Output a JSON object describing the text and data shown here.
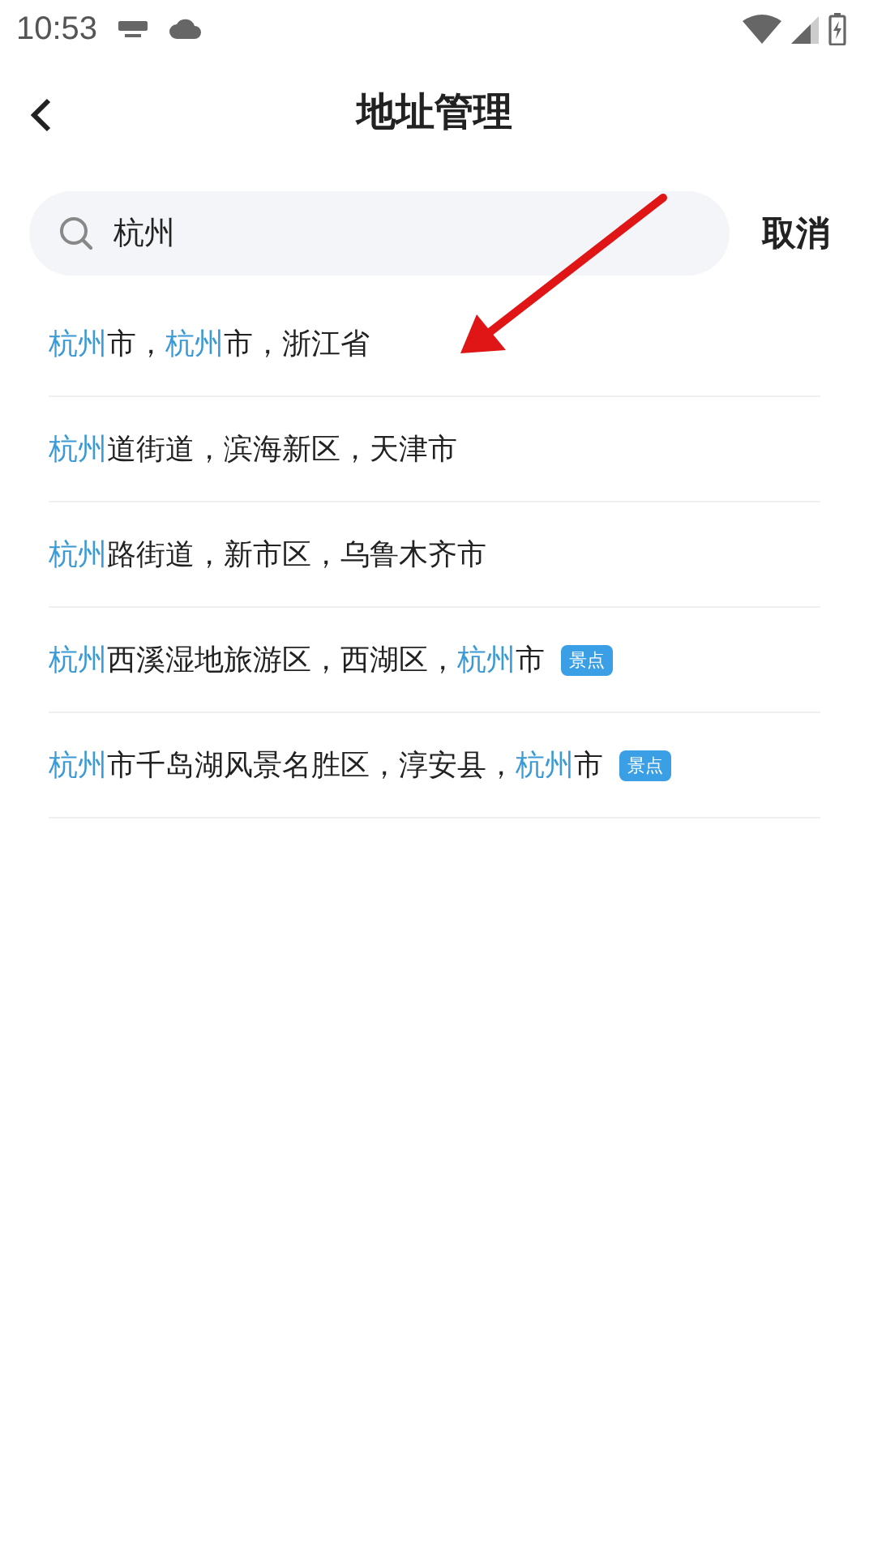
{
  "status_bar": {
    "time": "10:53"
  },
  "header": {
    "title": "地址管理"
  },
  "search": {
    "value": "杭州",
    "cancel": "取消"
  },
  "results": [
    {
      "segments": [
        {
          "text": "杭州",
          "highlight": true
        },
        {
          "text": "市，",
          "highlight": false
        },
        {
          "text": "杭州",
          "highlight": true
        },
        {
          "text": "市，浙江省",
          "highlight": false
        }
      ]
    },
    {
      "segments": [
        {
          "text": "杭州",
          "highlight": true
        },
        {
          "text": "道街道，滨海新区，天津市",
          "highlight": false
        }
      ]
    },
    {
      "segments": [
        {
          "text": "杭州",
          "highlight": true
        },
        {
          "text": "路街道，新市区，乌鲁木齐市",
          "highlight": false
        }
      ]
    },
    {
      "segments": [
        {
          "text": "杭州",
          "highlight": true
        },
        {
          "text": "西溪湿地旅游区，西湖区，",
          "highlight": false
        },
        {
          "text": "杭州",
          "highlight": true
        },
        {
          "text": "市",
          "highlight": false
        }
      ],
      "badge": "景点"
    },
    {
      "segments": [
        {
          "text": "杭州",
          "highlight": true
        },
        {
          "text": "市千岛湖风景名胜区，淳安县，",
          "highlight": false
        },
        {
          "text": "杭州",
          "highlight": true
        },
        {
          "text": "市",
          "highlight": false
        }
      ],
      "badge": "景点"
    }
  ]
}
